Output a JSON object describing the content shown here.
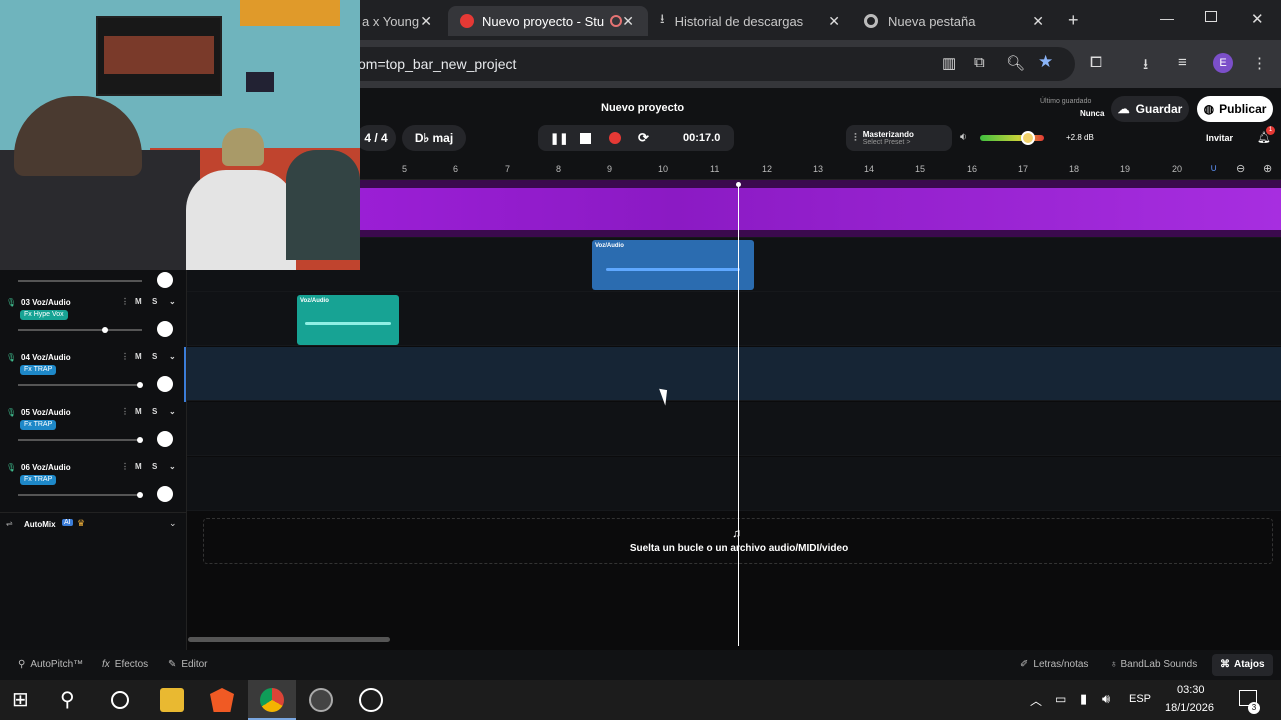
{
  "browser": {
    "tabs": [
      {
        "label": "a x Young"
      },
      {
        "label": "Nuevo proyecto - Stu"
      },
      {
        "label": "Historial de descargas"
      },
      {
        "label": "Nueva pestaña"
      }
    ],
    "url": "om=top_bar_new_project",
    "profile_letter": "E"
  },
  "app": {
    "project_title": "Nuevo proyecto",
    "last_saved_label": "Último guardado",
    "last_saved_value": "Nunca",
    "save_label": "Guardar",
    "publish_label": "Publicar",
    "invite_label": "Invitar",
    "time_signature": "4 / 4",
    "key": "D♭ maj",
    "time": "00:17.0",
    "mastering_label": "Masterizando",
    "mastering_preset": "Select Preset >",
    "volume_db": "+2.8 dB",
    "notification_count": "1",
    "ruler_ticks": [
      "5",
      "6",
      "7",
      "8",
      "9",
      "10",
      "11",
      "12",
      "13",
      "14",
      "15",
      "16",
      "17",
      "18",
      "19",
      "20"
    ]
  },
  "tracks": [
    {
      "name": "03 Voz/Audio",
      "fx": "Fx Hype Vox"
    },
    {
      "name": "04 Voz/Audio",
      "fx": "Fx TRAP"
    },
    {
      "name": "05 Voz/Audio",
      "fx": "Fx TRAP"
    },
    {
      "name": "06 Voz/Audio",
      "fx": "Fx TRAP"
    }
  ],
  "track_buttons": {
    "mute": "M",
    "solo": "S"
  },
  "clips": {
    "clip_blue": "Voz/Audio",
    "clip_teal": "Voz/Audio"
  },
  "automix_label": "AutoMix",
  "automix_badge": "AI",
  "dropzone_text": "Suelta un bucle o un archivo audio/MIDI/video",
  "bottom": {
    "autopitch": "AutoPitch™",
    "effects": "Efectos",
    "editor": "Editor",
    "lyrics": "Letras/notas",
    "sounds": "BandLab Sounds",
    "shortcuts": "Atajos"
  },
  "taskbar": {
    "lang": "ESP",
    "time": "03:30",
    "date": "18/1/2026",
    "notif_count": "3"
  },
  "colors": {
    "accent_purple": "#9b1fd6",
    "clip_blue": "#2b6cb0",
    "clip_teal": "#17a394",
    "fx_blue": "#1e88c8"
  }
}
